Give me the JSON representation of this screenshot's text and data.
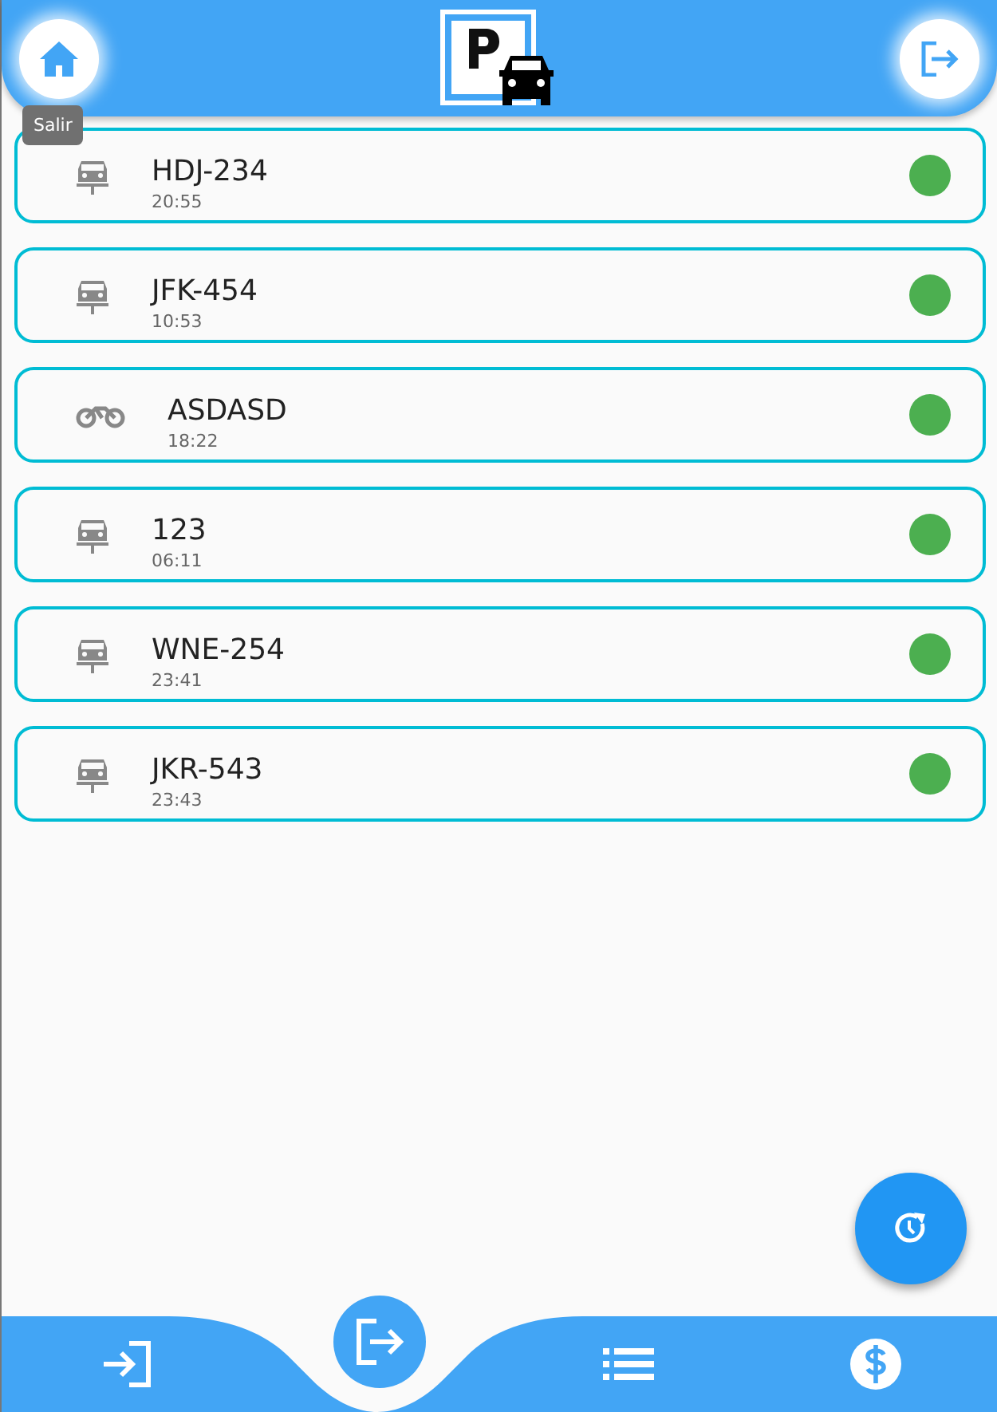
{
  "header": {
    "tooltip": "Salir"
  },
  "vehicles": [
    {
      "kind": "car",
      "plate": "HDJ-234",
      "time": "20:55",
      "color": "#4caf50"
    },
    {
      "kind": "car",
      "plate": "JFK-454",
      "time": "10:53",
      "color": "#4caf50"
    },
    {
      "kind": "motorcycle",
      "plate": "ASDASD",
      "time": "18:22",
      "color": "#4caf50"
    },
    {
      "kind": "car",
      "plate": "123",
      "time": "06:11",
      "color": "#4caf50"
    },
    {
      "kind": "car",
      "plate": "WNE-254",
      "time": "23:41",
      "color": "#4caf50"
    },
    {
      "kind": "car",
      "plate": "JKR-543",
      "time": "23:43",
      "color": "#4caf50"
    }
  ],
  "bottom_nav": [
    {
      "kind": "entry",
      "selected": false
    },
    {
      "kind": "exit",
      "selected": true
    },
    {
      "kind": "list",
      "selected": false
    },
    {
      "kind": "payment",
      "selected": false
    }
  ]
}
